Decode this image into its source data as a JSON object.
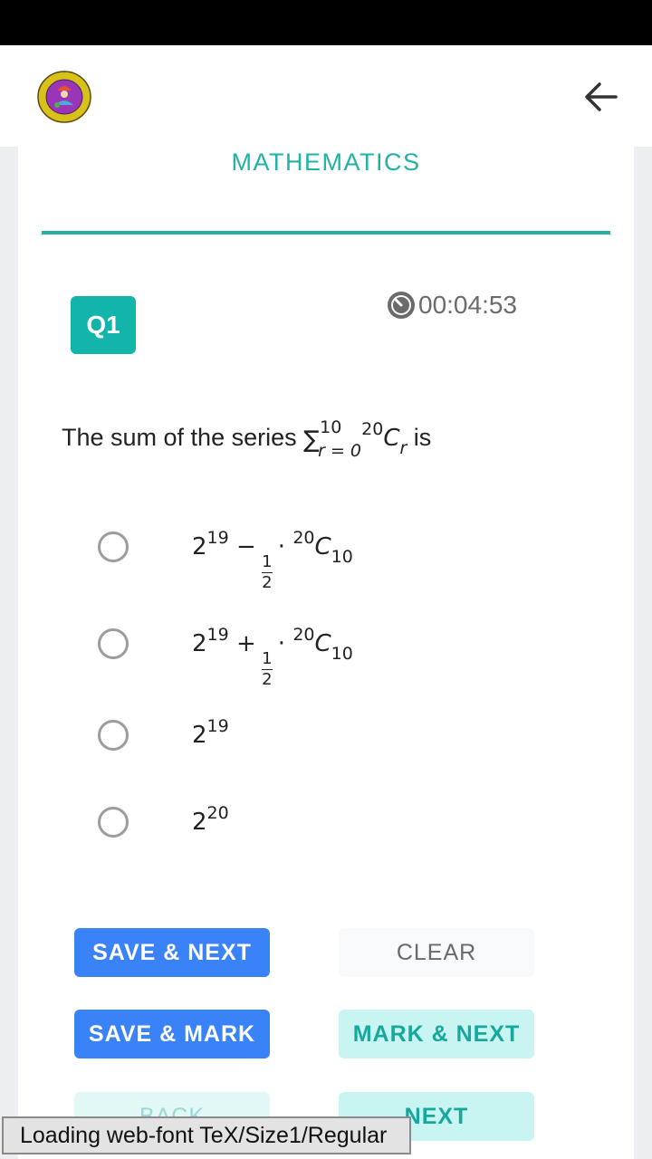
{
  "header": {
    "logo_alt": "institution-emblem",
    "back_icon": "arrow-left-icon"
  },
  "subject": {
    "title": "MATHEMATICS"
  },
  "question": {
    "number_label": "Q1",
    "timer_icon": "stopwatch-icon",
    "timer": "00:04:53",
    "text_prefix": "The sum of the series ",
    "sum_symbol": "∑",
    "sum_upper": "10",
    "sum_lower": "r = 0",
    "term_sup": "20",
    "term_base": "C",
    "term_sub": "r",
    "text_suffix": " is"
  },
  "options": [
    {
      "base": "2",
      "exp": "19",
      "op": "−",
      "frac_num": "1",
      "frac_den": "2",
      "dot": "·",
      "c_sup": "20",
      "c_base": "C",
      "c_sub": "10",
      "selected": false
    },
    {
      "base": "2",
      "exp": "19",
      "op": "+",
      "frac_num": "1",
      "frac_den": "2",
      "dot": "·",
      "c_sup": "20",
      "c_base": "C",
      "c_sub": "10",
      "selected": false
    },
    {
      "base": "2",
      "exp": "19",
      "selected": false
    },
    {
      "base": "2",
      "exp": "20",
      "selected": false
    }
  ],
  "buttons": {
    "save_next": "SAVE & NEXT",
    "clear": "CLEAR",
    "save_mark": "SAVE & MARK",
    "mark_next": "MARK & NEXT",
    "back": "BACK",
    "next": "NEXT"
  },
  "toast": {
    "text": "Loading web-font TeX/Size1/Regular"
  },
  "colors": {
    "accent_teal": "#13b5ab",
    "primary_blue": "#3a82f7",
    "teal_light": "#c8f4f1"
  }
}
